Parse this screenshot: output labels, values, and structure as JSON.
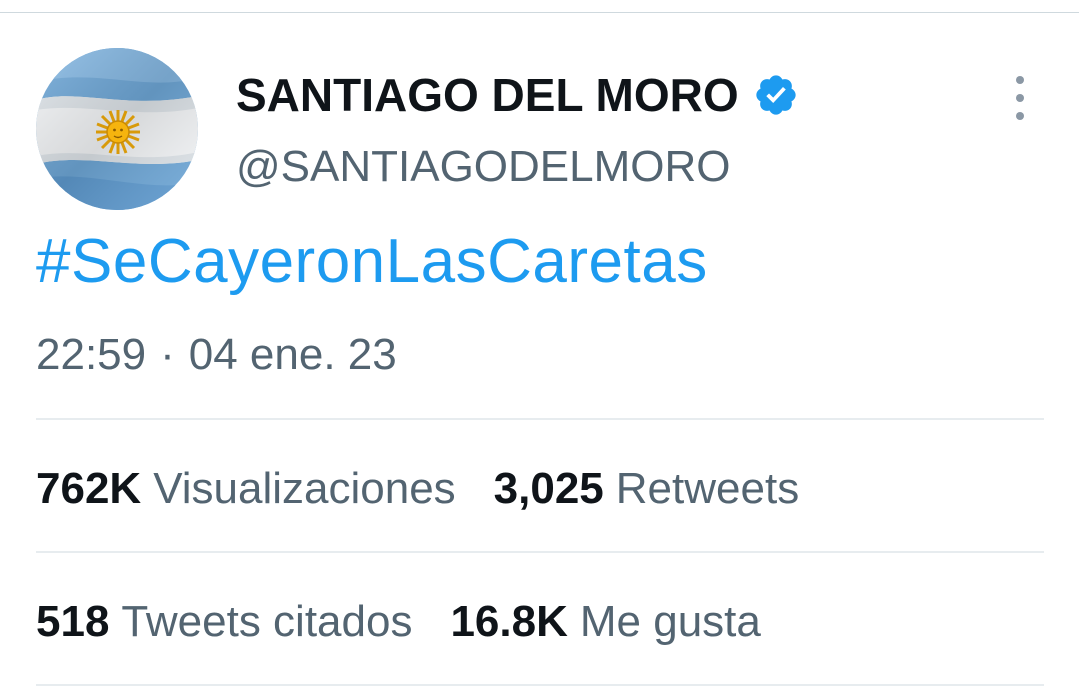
{
  "author": {
    "display_name": "SANTIAGO DEL MORO",
    "handle": "@SANTIAGODELMORO"
  },
  "tweet": {
    "text": "#SeCayeronLasCaretas",
    "time": "22:59",
    "separator": "·",
    "date": "04 ene. 23"
  },
  "stats": {
    "views": {
      "value": "762K",
      "label": "Visualizaciones"
    },
    "retweets": {
      "value": "3,025",
      "label": "Retweets"
    },
    "quotes": {
      "value": "518",
      "label": "Tweets citados"
    },
    "likes": {
      "value": "16.8K",
      "label": "Me gusta"
    }
  },
  "icons": {
    "avatar": "argentina-flag-avatar",
    "verified": "verified-badge-icon",
    "more": "more-options-icon"
  },
  "colors": {
    "hashtag": "#1d9bf0",
    "verified": "#1d9bf0",
    "secondary_text": "#536471",
    "divider": "#e7ecef",
    "flag_blue": "#74acdf",
    "sun": "#f6b40e"
  }
}
